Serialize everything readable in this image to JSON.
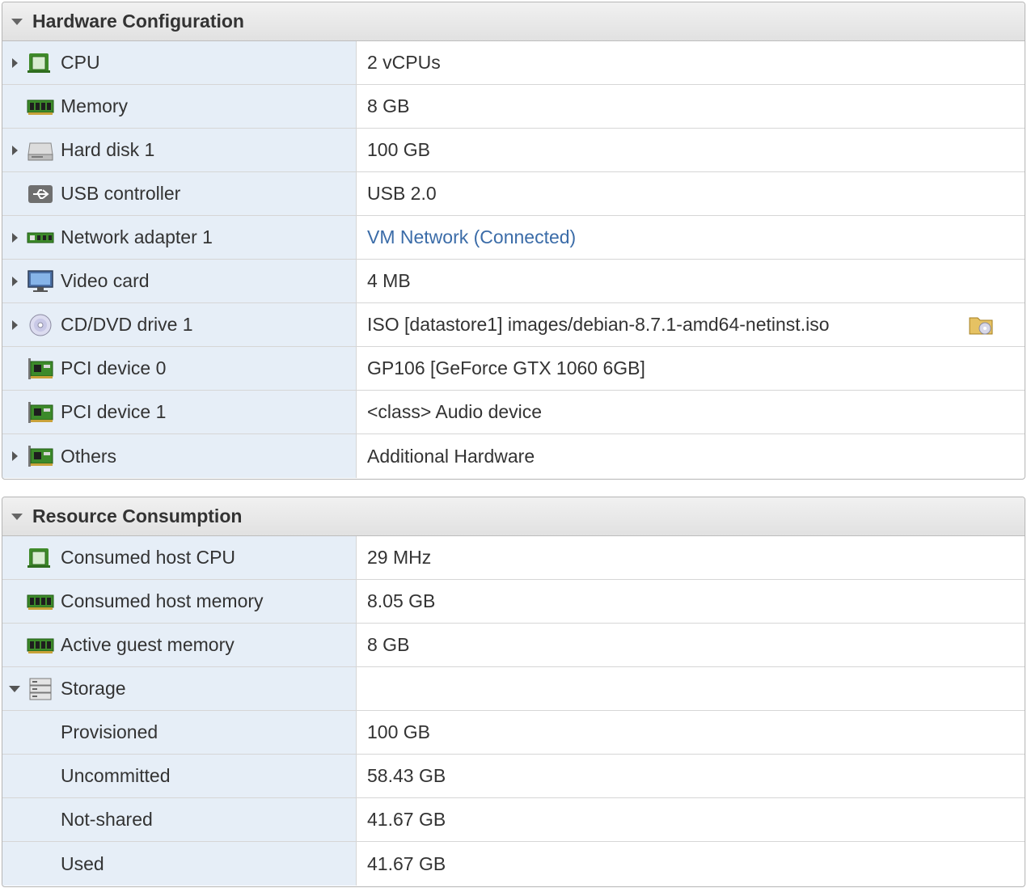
{
  "hardware": {
    "title": "Hardware Configuration",
    "rows": [
      {
        "name": "CPU",
        "value": "2 vCPUs"
      },
      {
        "name": "Memory",
        "value": "8 GB"
      },
      {
        "name": "Hard disk 1",
        "value": "100 GB"
      },
      {
        "name": "USB controller",
        "value": "USB 2.0"
      },
      {
        "name": "Network adapter 1",
        "value": "VM Network (Connected)"
      },
      {
        "name": "Video card",
        "value": "4 MB"
      },
      {
        "name": "CD/DVD drive 1",
        "value": "ISO [datastore1] images/debian-8.7.1-amd64-netinst.iso"
      },
      {
        "name": "PCI device 0",
        "value": "GP106 [GeForce GTX 1060 6GB]"
      },
      {
        "name": "PCI device 1",
        "value": "<class> Audio device"
      },
      {
        "name": "Others",
        "value": "Additional Hardware"
      }
    ]
  },
  "resources": {
    "title": "Resource Consumption",
    "rows": [
      {
        "name": "Consumed host CPU",
        "value": "29 MHz"
      },
      {
        "name": "Consumed host memory",
        "value": "8.05 GB"
      },
      {
        "name": "Active guest memory",
        "value": "8 GB"
      },
      {
        "name": "Storage",
        "value": ""
      },
      {
        "name": "Provisioned",
        "value": "100 GB"
      },
      {
        "name": "Uncommitted",
        "value": "58.43 GB"
      },
      {
        "name": "Not-shared",
        "value": "41.67 GB"
      },
      {
        "name": "Used",
        "value": "41.67 GB"
      }
    ]
  },
  "icons": {
    "cpu": "cpu-chip-icon",
    "memory": "memory-module-icon",
    "disk": "hard-disk-icon",
    "usb": "usb-icon",
    "network": "network-card-icon",
    "video": "monitor-icon",
    "cdrom": "optical-disc-icon",
    "pci": "pci-card-icon",
    "storage": "storage-stack-icon",
    "folder": "browse-folder-icon"
  },
  "colors": {
    "header_bg": "#e6e6e6",
    "name_cell_bg": "#e6eef7",
    "link": "#3b6ca8",
    "border": "#d6d6d6"
  }
}
